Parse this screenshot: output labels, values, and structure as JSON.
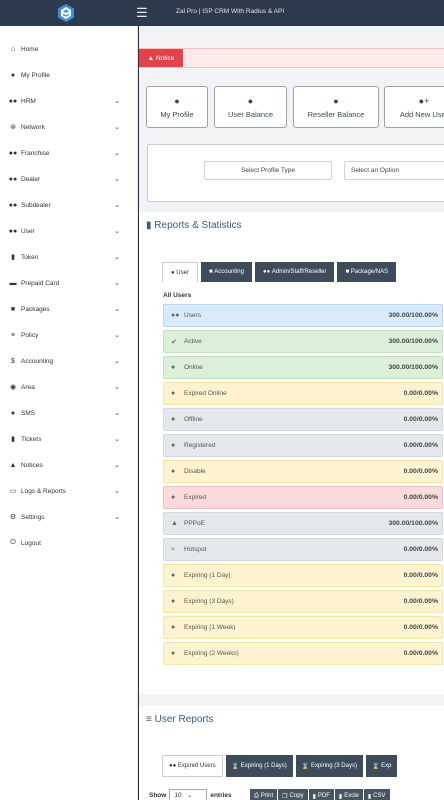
{
  "header": {
    "title": "Zal Pro | ISP CRM With Radius & API",
    "menu_icon": "hamburger-icon",
    "logo_icon": "logo-icon",
    "colors": {
      "topbar": "#2e3a4e",
      "notice": "#e2434b",
      "accent": "#3d5a78"
    }
  },
  "sidebar": {
    "items": [
      {
        "label": "Home",
        "icon": "home-icon",
        "chevron": false
      },
      {
        "label": "My Profile",
        "icon": "user-icon",
        "chevron": false
      },
      {
        "label": "HRM",
        "icon": "users-icon",
        "chevron": true
      },
      {
        "label": "Network",
        "icon": "network-icon",
        "chevron": true
      },
      {
        "label": "Franchise",
        "icon": "users-icon",
        "chevron": true
      },
      {
        "label": "Dealer",
        "icon": "users-icon",
        "chevron": true
      },
      {
        "label": "Subdealer",
        "icon": "users-icon",
        "chevron": true
      },
      {
        "label": "User",
        "icon": "users-icon",
        "chevron": true
      },
      {
        "label": "Token",
        "icon": "ticket-icon",
        "chevron": true
      },
      {
        "label": "Prepaid Card",
        "icon": "card-icon",
        "chevron": true
      },
      {
        "label": "Packages",
        "icon": "cube-icon",
        "chevron": true
      },
      {
        "label": "Policy",
        "icon": "list-icon",
        "chevron": true
      },
      {
        "label": "Accounting",
        "icon": "dollar-icon",
        "chevron": true
      },
      {
        "label": "Area",
        "icon": "map-pin-icon",
        "chevron": true
      },
      {
        "label": "SMS",
        "icon": "chat-icon",
        "chevron": true
      },
      {
        "label": "Tickets",
        "icon": "ticket-icon",
        "chevron": true
      },
      {
        "label": "Notices",
        "icon": "bell-icon",
        "chevron": true
      },
      {
        "label": "Logs & Reports",
        "icon": "file-icon",
        "chevron": true
      },
      {
        "label": "Settings",
        "icon": "gear-icon",
        "chevron": true
      },
      {
        "label": "Logout",
        "icon": "power-icon",
        "chevron": false
      }
    ]
  },
  "notice": {
    "label": "Notice",
    "icon": "bell-icon"
  },
  "quick_buttons": [
    {
      "label": "My Profile",
      "icon": "user-icon"
    },
    {
      "label": "User Balance",
      "icon": "user-icon"
    },
    {
      "label": "Reseller Balance",
      "icon": "user-icon"
    },
    {
      "label": "Add New User",
      "icon": "user-plus-icon"
    }
  ],
  "filters": {
    "profile_type": "Select Profile Type",
    "option": "Select an Option"
  },
  "reports": {
    "title": "Reports & Statistics",
    "tabs": [
      {
        "label": "User",
        "icon": "user-icon"
      },
      {
        "label": "Accounting",
        "icon": "dollar-icon"
      },
      {
        "label": "Admin/Staff/Reseller",
        "icon": "users-icon"
      },
      {
        "label": "Package/NAS",
        "icon": "cube-icon"
      }
    ],
    "group_label": "All Users",
    "rows": [
      {
        "label": "Users",
        "value": "300.00/100.00%",
        "color": "blue",
        "icon": "users-icon"
      },
      {
        "label": "Active",
        "value": "300.00/100.00%",
        "color": "green",
        "icon": "check-circle-icon"
      },
      {
        "label": "Online",
        "value": "300.00/100.00%",
        "color": "green",
        "icon": "user-online-icon"
      },
      {
        "label": "Expired Online",
        "value": "0.00/0.00%",
        "color": "yellow",
        "icon": "user-clock-icon"
      },
      {
        "label": "Offline",
        "value": "0.00/0.00%",
        "color": "gray",
        "icon": "user-off-icon"
      },
      {
        "label": "Registered",
        "value": "0.00/0.00%",
        "color": "gray",
        "icon": "user-icon"
      },
      {
        "label": "Disable",
        "value": "0.00/0.00%",
        "color": "yellow",
        "icon": "user-minus-icon"
      },
      {
        "label": "Expired",
        "value": "0.00/0.00%",
        "color": "red",
        "icon": "user-icon"
      },
      {
        "label": "PPPoE",
        "value": "300.00/100.00%",
        "color": "gray",
        "icon": "network-icon"
      },
      {
        "label": "Hotspot",
        "value": "0.00/0.00%",
        "color": "gray",
        "icon": "wifi-icon"
      },
      {
        "label": "Expiring (1 Day)",
        "value": "0.00/0.00%",
        "color": "yellow",
        "icon": "user-clock-icon"
      },
      {
        "label": "Expiring (3 Days)",
        "value": "0.00/0.00%",
        "color": "yellow",
        "icon": "user-clock-icon"
      },
      {
        "label": "Expiring (1 Week)",
        "value": "0.00/0.00%",
        "color": "yellow",
        "icon": "user-clock-icon"
      },
      {
        "label": "Expiring (2 Weeks)",
        "value": "0.00/0.00%",
        "color": "yellow",
        "icon": "user-clock-icon"
      }
    ]
  },
  "user_reports": {
    "title": "User Reports",
    "tabs": [
      {
        "label": "Expired Users",
        "icon": "users-icon"
      },
      {
        "label": "Expiring (1 Days)",
        "icon": "hourglass-icon"
      },
      {
        "label": "Expiring (3 Days)",
        "icon": "hourglass-icon"
      },
      {
        "label": "Exp",
        "icon": "hourglass-icon"
      }
    ],
    "show_label": "Show",
    "show_value": "10",
    "entries_label": "entries",
    "export_buttons": [
      {
        "label": "Print",
        "icon": "print-icon"
      },
      {
        "label": "Copy",
        "icon": "copy-icon"
      },
      {
        "label": "PDF",
        "icon": "pdf-icon"
      },
      {
        "label": "Excle",
        "icon": "excel-icon"
      },
      {
        "label": "CSV",
        "icon": "csv-icon"
      }
    ]
  }
}
